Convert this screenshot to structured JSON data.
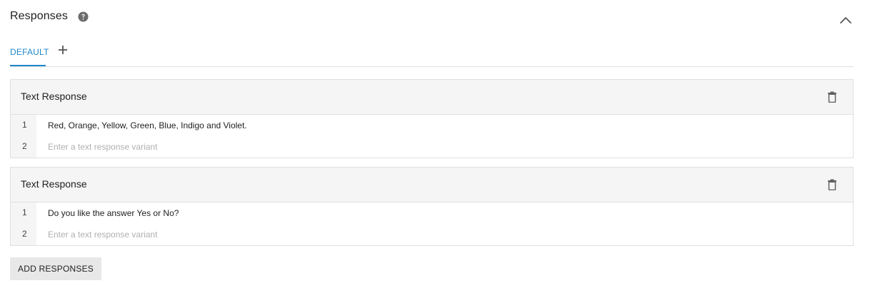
{
  "section": {
    "title": "Responses",
    "help_icon": "help-circle-icon",
    "collapse_icon": "chevron-up-icon"
  },
  "tabs": {
    "items": [
      {
        "label": "DEFAULT",
        "active": true
      }
    ],
    "add_icon": "plus-icon"
  },
  "colors": {
    "accent": "#1e88c9",
    "card_header_bg": "#f5f5f5",
    "border": "#e0e0e0",
    "button_bg": "#e8e8e8",
    "placeholder": "#b0b0b0"
  },
  "cards": [
    {
      "title": "Text Response",
      "delete_icon": "trash-icon",
      "rows": [
        {
          "num": "1",
          "value": "Red, Orange, Yellow, Green, Blue, Indigo and Violet."
        },
        {
          "num": "2",
          "placeholder": "Enter a text response variant"
        }
      ]
    },
    {
      "title": "Text Response",
      "delete_icon": "trash-icon",
      "rows": [
        {
          "num": "1",
          "value": "Do you like the answer Yes or No?"
        },
        {
          "num": "2",
          "placeholder": "Enter a text response variant"
        }
      ]
    }
  ],
  "add_responses_label": "ADD RESPONSES"
}
